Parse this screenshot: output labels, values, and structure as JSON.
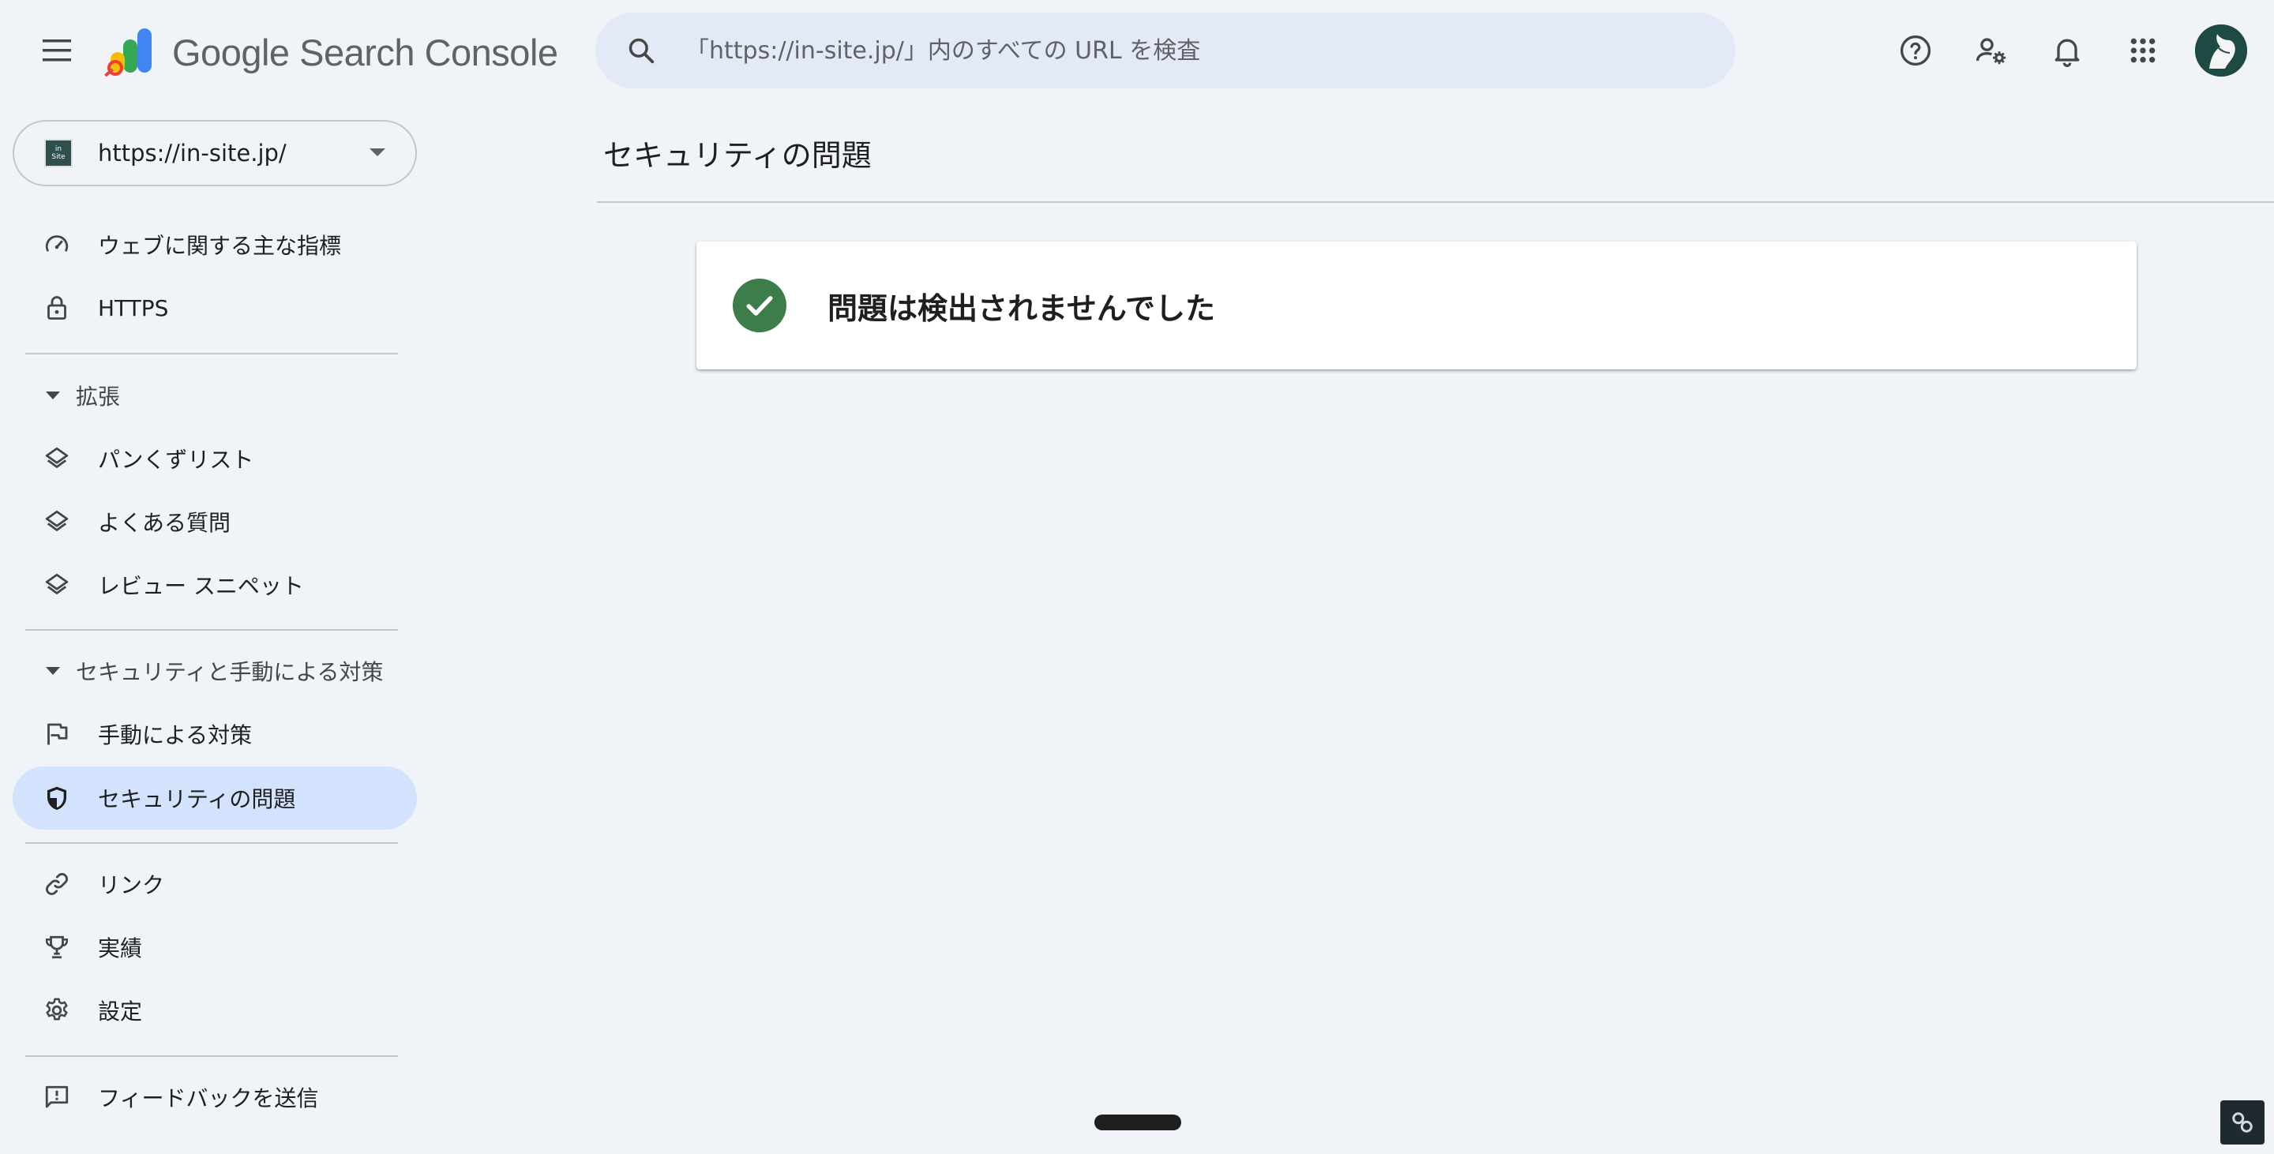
{
  "app": {
    "name": "Google Search Console",
    "brand_colors": [
      "#4285f4",
      "#34a853",
      "#fbbc04",
      "#ea4335"
    ]
  },
  "header": {
    "search_placeholder": "「https://in-site.jp/」内のすべての URL を検査",
    "icons": [
      "help-icon",
      "manage-users-icon",
      "notifications-icon",
      "apps-grid-icon"
    ]
  },
  "property": {
    "url": "https://in-site.jp/",
    "favicon_top": "in",
    "favicon_bottom": "Site"
  },
  "sidebar": {
    "items": [
      {
        "label": "ウェブに関する主な指標",
        "icon": "speed-gauge-icon"
      },
      {
        "label": "HTTPS",
        "icon": "lock-icon"
      },
      {
        "label": "拡張",
        "icon": "section-caret-icon"
      },
      {
        "label": "パンくずリスト",
        "icon": "layers-icon"
      },
      {
        "label": "よくある質問",
        "icon": "layers-icon"
      },
      {
        "label": "レビュー スニペット",
        "icon": "layers-icon"
      },
      {
        "label": "セキュリティと手動による対策",
        "icon": "section-caret-icon"
      },
      {
        "label": "手動による対策",
        "icon": "flag-icon"
      },
      {
        "label": "セキュリティの問題",
        "icon": "shield-icon",
        "active": true
      },
      {
        "label": "リンク",
        "icon": "link-icon"
      },
      {
        "label": "実績",
        "icon": "trophy-icon"
      },
      {
        "label": "設定",
        "icon": "gear-icon"
      },
      {
        "label": "フィードバックを送信",
        "icon": "feedback-icon"
      }
    ]
  },
  "main": {
    "title": "セキュリティの問題",
    "status_message": "問題は検出されませんでした",
    "status_color": "#3c7d4a"
  },
  "colors": {
    "background": "#f0f4f9",
    "active_nav": "#d3e3fd",
    "search_bg": "#e3e9f6"
  }
}
